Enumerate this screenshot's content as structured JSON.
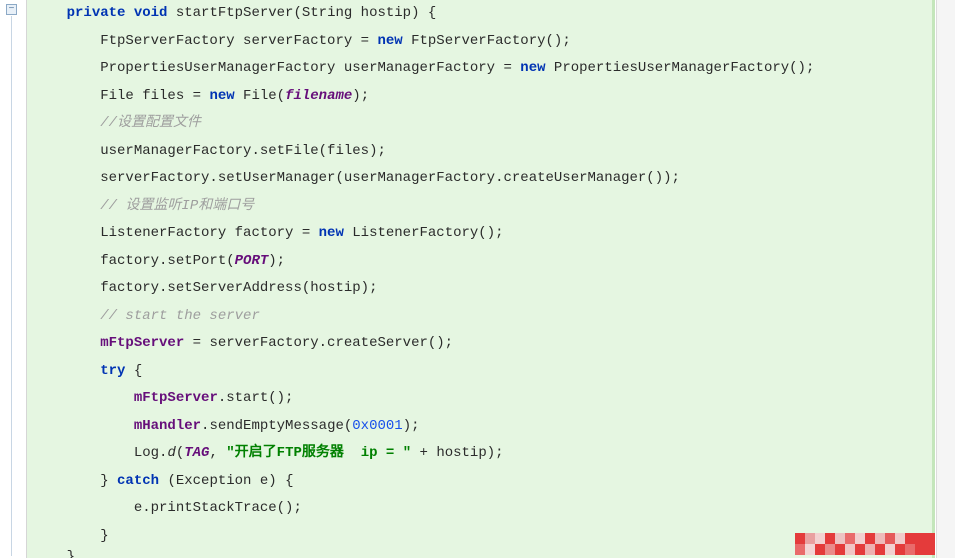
{
  "gutter": {
    "fold_symbol": "−"
  },
  "code": {
    "indent1": "    ",
    "indent2": "        ",
    "indent3": "            ",
    "l1": {
      "kw1": "private",
      "sp": " ",
      "kw2": "void",
      "sig": " startFtpServer(String hostip) {"
    },
    "l2": {
      "pre": "FtpServerFactory serverFactory = ",
      "kw": "new",
      "post": " FtpServerFactory();"
    },
    "l3": {
      "pre": "PropertiesUserManagerFactory userManagerFactory = ",
      "kw": "new",
      "post": " PropertiesUserManagerFactory();"
    },
    "l4": {
      "pre": "File files = ",
      "kw": "new",
      "mid": " File(",
      "fld": "filename",
      "post": ");"
    },
    "l5": {
      "cmt": "//设置配置文件"
    },
    "l6": {
      "txt": "userManagerFactory.setFile(files);"
    },
    "l7": {
      "txt": "serverFactory.setUserManager(userManagerFactory.createUserManager());"
    },
    "l8": {
      "cmt": "// 设置监听IP和端口号"
    },
    "l9": {
      "pre": "ListenerFactory factory = ",
      "kw": "new",
      "post": " ListenerFactory();"
    },
    "l10": {
      "pre": "factory.setPort(",
      "fld": "PORT",
      "post": ");"
    },
    "l11": {
      "txt": "factory.setServerAddress(hostip);"
    },
    "l12": {
      "cmt": "// start the server"
    },
    "l13": {
      "fld": "mFtpServer",
      "post": " = serverFactory.createServer();"
    },
    "l14": {
      "kw": "try",
      "post": " {"
    },
    "l15": {
      "fld": "mFtpServer",
      "post": ".start();"
    },
    "l16": {
      "fld": "mHandler",
      "mid": ".sendEmptyMessage(",
      "num": "0x0001",
      "post": ");"
    },
    "l17": {
      "pre": "Log.",
      "call": "d",
      "open": "(",
      "fld": "TAG",
      "comma": ", ",
      "str": "\"开启了FTP服务器  ip = \"",
      "post": " + hostip);"
    },
    "l18": {
      "close": "} ",
      "kw": "catch",
      "post": " (Exception e) {"
    },
    "l19": {
      "txt": "e.printStackTrace();"
    },
    "l20": {
      "txt": "}"
    },
    "l21": {
      "txt": "}"
    }
  }
}
